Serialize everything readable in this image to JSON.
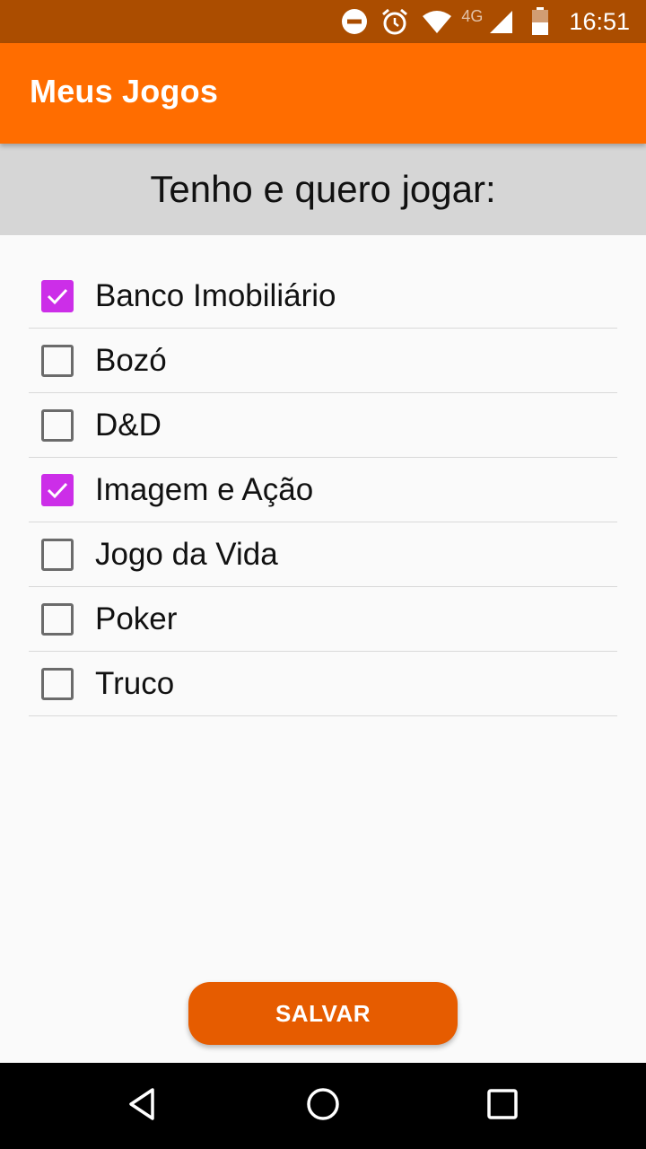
{
  "status_bar": {
    "icons": [
      "do-not-disturb-icon",
      "alarm-icon",
      "wifi-icon",
      "signal-icon",
      "battery-icon"
    ],
    "network_label": "4G",
    "battery_level": "40",
    "time": "16:51"
  },
  "app_bar": {
    "title": "Meus Jogos",
    "color": "#ff6d00"
  },
  "section": {
    "title": "Tenho e quero jogar:"
  },
  "games": [
    {
      "label": "Banco Imobiliário",
      "checked": true
    },
    {
      "label": "Bozó",
      "checked": false
    },
    {
      "label": "D&D",
      "checked": false
    },
    {
      "label": "Imagem e Ação",
      "checked": true
    },
    {
      "label": "Jogo da Vida",
      "checked": false
    },
    {
      "label": "Poker",
      "checked": false
    },
    {
      "label": "Truco",
      "checked": false
    }
  ],
  "save_button": {
    "label": "SALVAR",
    "color": "#e65c00"
  },
  "checkbox_accent": "#cc2ee8",
  "nav_bar": {
    "icons": [
      "back-icon",
      "home-icon",
      "recents-icon"
    ]
  }
}
